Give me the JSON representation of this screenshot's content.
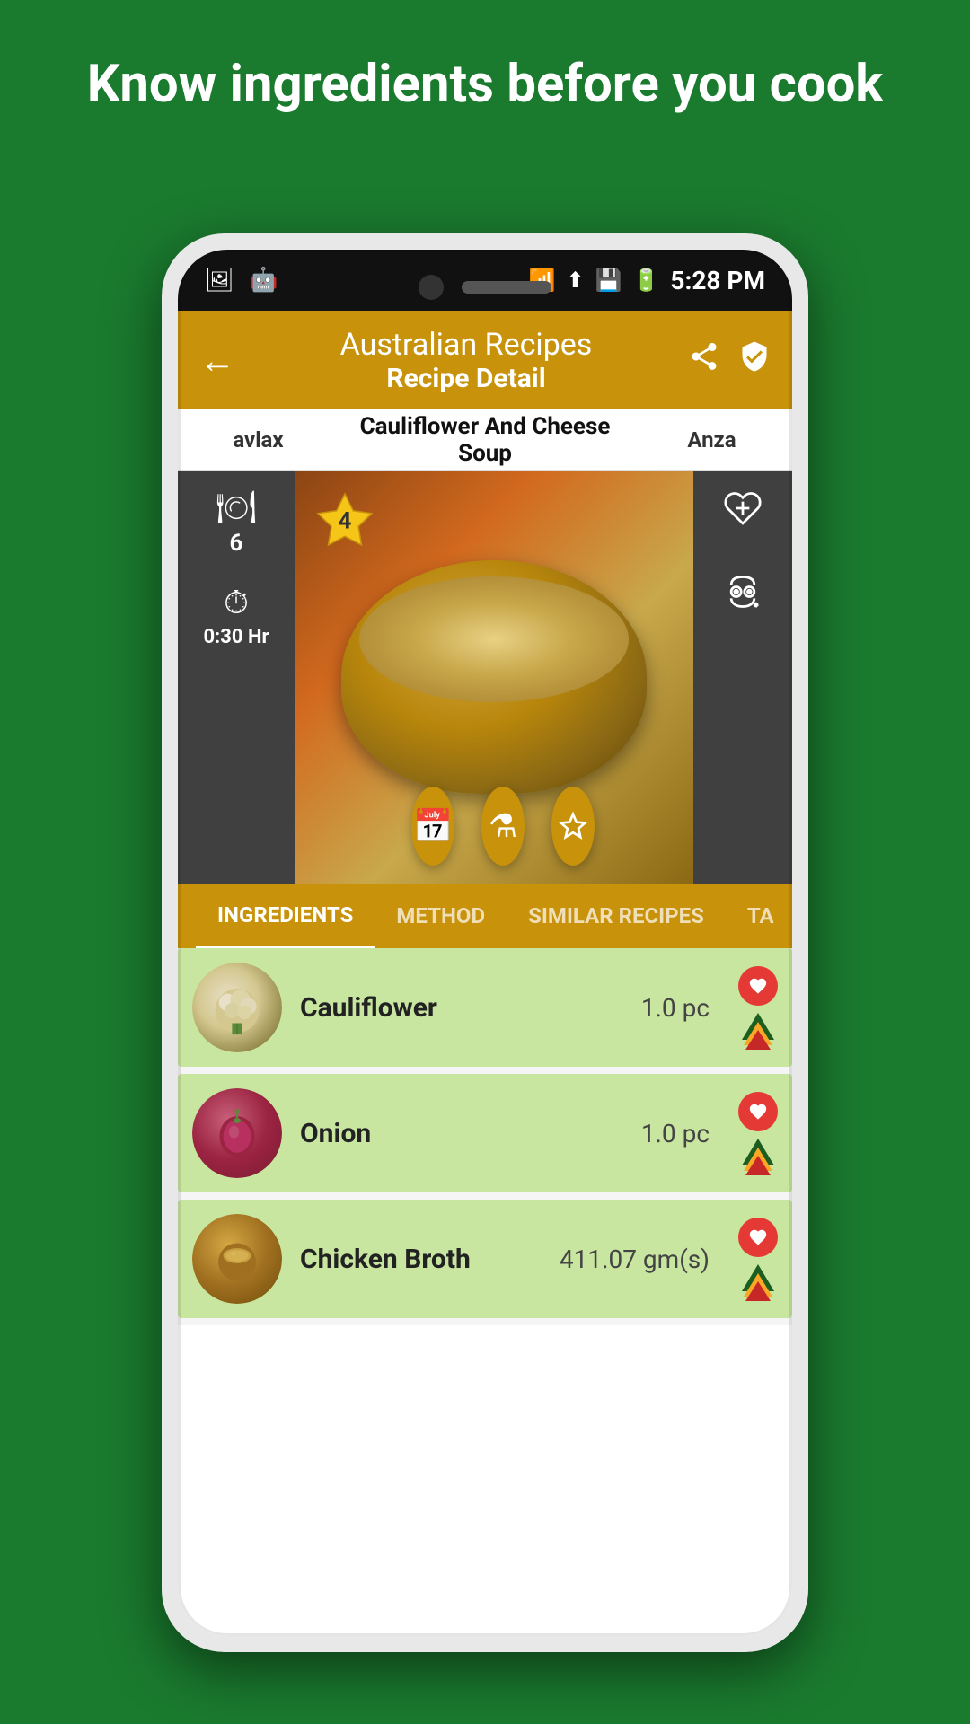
{
  "page": {
    "headline": "Know ingredients before you cook"
  },
  "status_bar": {
    "time": "5:28 PM",
    "icons": [
      "image",
      "android",
      "wifi",
      "signal",
      "sd",
      "battery"
    ]
  },
  "app_bar": {
    "title": "Australian Recipes",
    "subtitle": "Recipe Detail",
    "back_label": "←",
    "share_label": "share",
    "shield_label": "shield"
  },
  "recipe_tabs": {
    "left": "avlax",
    "center": "Cauliflower And Cheese Soup",
    "right": "Anza"
  },
  "recipe_info": {
    "servings": "6",
    "time": "0:30 Hr",
    "rating": "4",
    "servings_icon": "🍽",
    "time_icon": "⏱"
  },
  "action_buttons": [
    {
      "id": "calendar-btn",
      "label": "📅"
    },
    {
      "id": "layer-btn",
      "label": "⚗"
    },
    {
      "id": "rate-btn",
      "label": "⭐"
    }
  ],
  "ingredient_tabs": [
    {
      "id": "ingredients-tab",
      "label": "INGREDIENTS",
      "active": true
    },
    {
      "id": "method-tab",
      "label": "METHOD",
      "active": false
    },
    {
      "id": "similar-tab",
      "label": "SIMILAR RECIPES",
      "active": false
    },
    {
      "id": "ta-tab",
      "label": "TA",
      "active": false
    }
  ],
  "ingredients": [
    {
      "id": "ingredient-cauliflower",
      "name": "Cauliflower",
      "amount": "1.0 pc",
      "avatar_type": "cauliflower"
    },
    {
      "id": "ingredient-onion",
      "name": "Onion",
      "amount": "1.0 pc",
      "avatar_type": "onion"
    },
    {
      "id": "ingredient-chicken-broth",
      "name": "Chicken Broth",
      "amount": "411.07 gm(s)",
      "avatar_type": "broth"
    }
  ]
}
